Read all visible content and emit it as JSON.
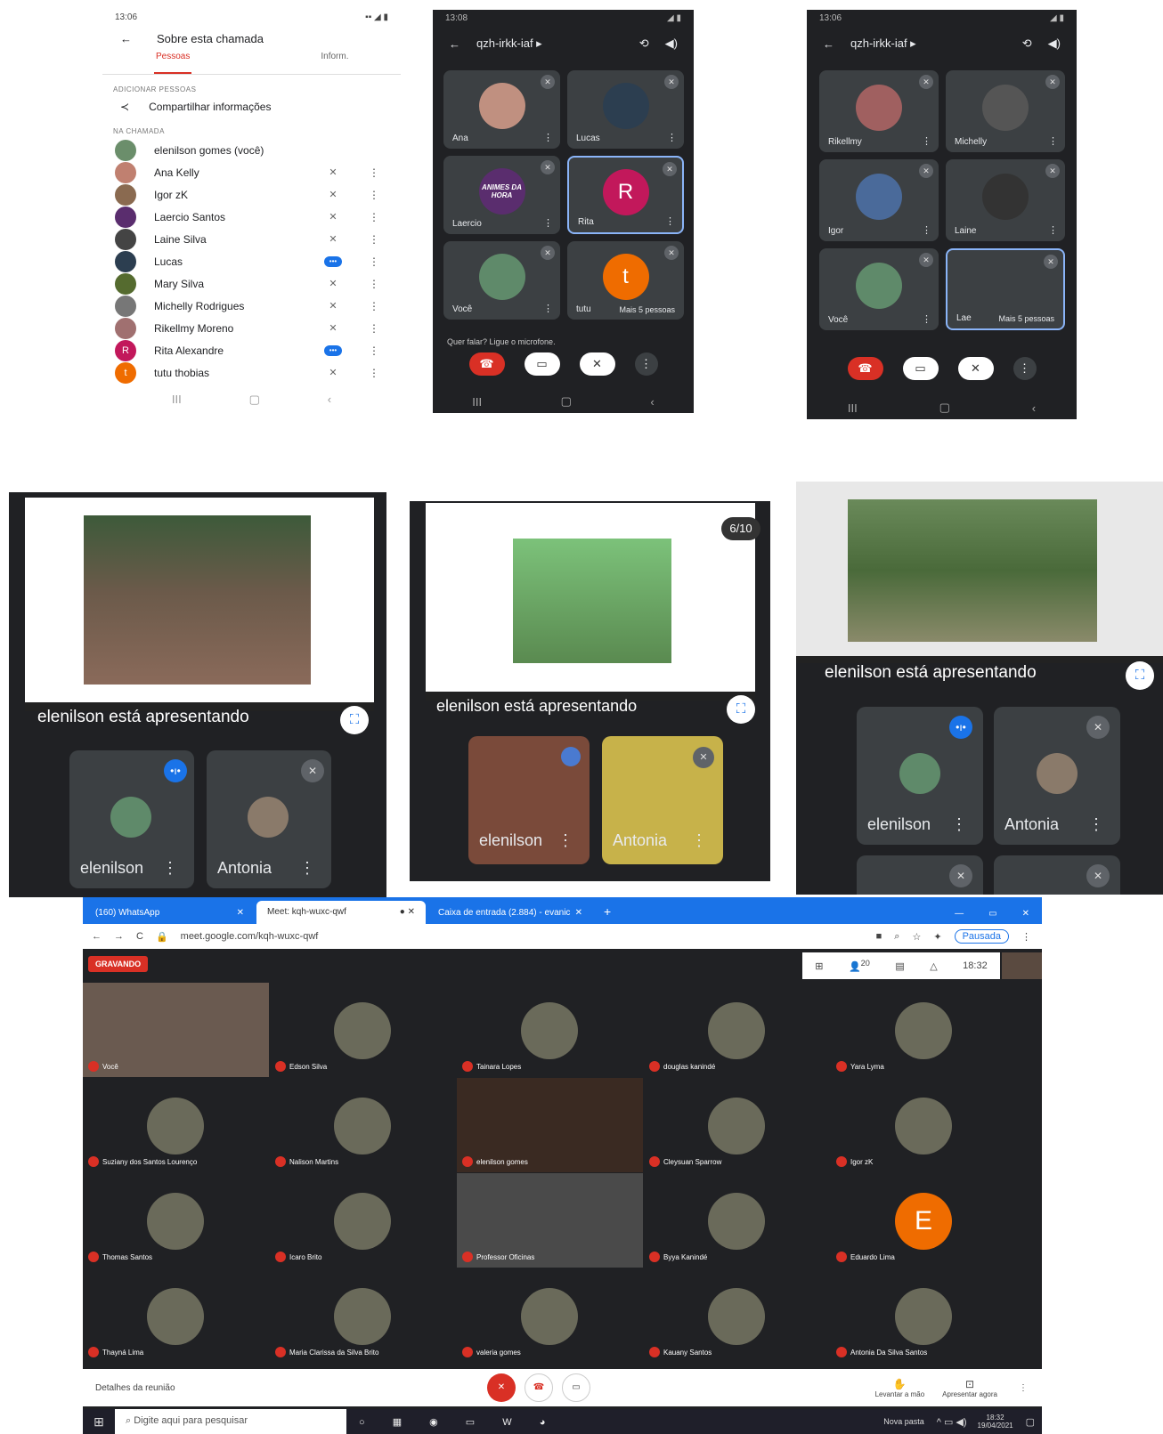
{
  "p1": {
    "time": "13:06",
    "title": "Sobre esta chamada",
    "tab_people": "Pessoas",
    "tab_info": "Inform.",
    "add_section": "ADICIONAR PESSOAS",
    "share": "Compartilhar informações",
    "in_call": "NA CHAMADA",
    "people": [
      {
        "name": "elenilson gomes (você)",
        "color": "#6b8e6b",
        "mic": ""
      },
      {
        "name": "Ana Kelly",
        "color": "#c08070",
        "mic": "muted"
      },
      {
        "name": "Igor zK",
        "color": "#8a6a50",
        "mic": "muted"
      },
      {
        "name": "Laercio Santos",
        "color": "#5a2d6e",
        "mic": "muted"
      },
      {
        "name": "Laine Silva",
        "color": "#444",
        "mic": "muted"
      },
      {
        "name": "Lucas",
        "color": "#2c3e50",
        "mic": "speaking"
      },
      {
        "name": "Mary Silva",
        "color": "#556b2f",
        "mic": "muted"
      },
      {
        "name": "Michelly Rodrigues",
        "color": "#777",
        "mic": "muted"
      },
      {
        "name": "Rikellmy Moreno",
        "color": "#a07070",
        "mic": "muted"
      },
      {
        "name": "Rita Alexandre",
        "color": "#c2185b",
        "mic": "speaking",
        "initial": "R"
      },
      {
        "name": "tutu thobias",
        "color": "#ef6c00",
        "mic": "muted",
        "initial": "t"
      }
    ]
  },
  "p2": {
    "time": "13:08",
    "code": "qzh-irkk-iaf ▸",
    "tiles": [
      {
        "name": "Ana",
        "color": "#c09080"
      },
      {
        "name": "Lucas",
        "color": "#2c3e50"
      },
      {
        "name": "Laercio",
        "color": "#5a2d6e",
        "logo": "ANIMES DA HORA"
      },
      {
        "name": "Rita",
        "color": "#c2185b",
        "initial": "R"
      },
      {
        "name": "Você",
        "color": "#5f8a6a"
      },
      {
        "name": "tutu",
        "color": "#ef6c00",
        "initial": "t",
        "more": "Mais 5 pessoas"
      }
    ],
    "hint": "Quer falar? Ligue o microfone."
  },
  "p3": {
    "time": "13:06",
    "code": "qzh-irkk-iaf ▸",
    "tiles": [
      {
        "name": "Rikellmy",
        "color": "#a06060"
      },
      {
        "name": "Michelly",
        "color": "#555"
      },
      {
        "name": "Igor",
        "color": "#4a6a9a"
      },
      {
        "name": "Laine",
        "color": "#333"
      },
      {
        "name": "Você",
        "color": "#5f8a6a"
      },
      {
        "name": "Lae",
        "more": "Mais 5 pessoas"
      }
    ]
  },
  "pres": [
    {
      "text": "elenilson está apresentando",
      "a": "elenilson",
      "b": "Antonia"
    },
    {
      "text": "elenilson está apresentando",
      "a": "elenilson",
      "b": "Antonia",
      "page": "6/10"
    },
    {
      "text": "elenilson está apresentando",
      "a": "elenilson",
      "b": "Antonia"
    }
  ],
  "browser": {
    "tabs": [
      "(160) WhatsApp",
      "Meet: kqh-wuxc-qwf",
      "Caixa de entrada (2.884) - evanic"
    ],
    "url": "meet.google.com/kqh-wuxc-qwf",
    "paused": "Pausada",
    "recording": "GRAVANDO",
    "clock": "18:32",
    "count": "20",
    "grid": [
      [
        "Você",
        "Edson Silva",
        "Tainara Lopes",
        "douglas kanindé",
        "Yara Lyma"
      ],
      [
        "Suziany dos Santos Lourenço",
        "Nalison Martins",
        "elenilson gomes",
        "Cleysuan Sparrow",
        "Igor zK"
      ],
      [
        "Thomas Santos",
        "Icaro Brito",
        "Professor Oficinas",
        "Byya Kanindé",
        "Eduardo Lima"
      ],
      [
        "Thayná Lima",
        "Maria Clarissa da Silva Brito",
        "valeria gomes",
        "Kauany Santos",
        "Antonia Da Silva Santos"
      ]
    ],
    "details": "Detalhes da reunião",
    "raise": "Levantar a mão",
    "present": "Apresentar agora",
    "search": "Digite aqui para pesquisar",
    "folder": "Nova pasta",
    "time": "18:32",
    "date": "19/04/2021"
  },
  "colors": {
    "meet_bg": "#202124",
    "tile": "#3c4043",
    "red": "#d93025",
    "blue": "#1a73e8",
    "win_blue": "#1a73e8"
  }
}
